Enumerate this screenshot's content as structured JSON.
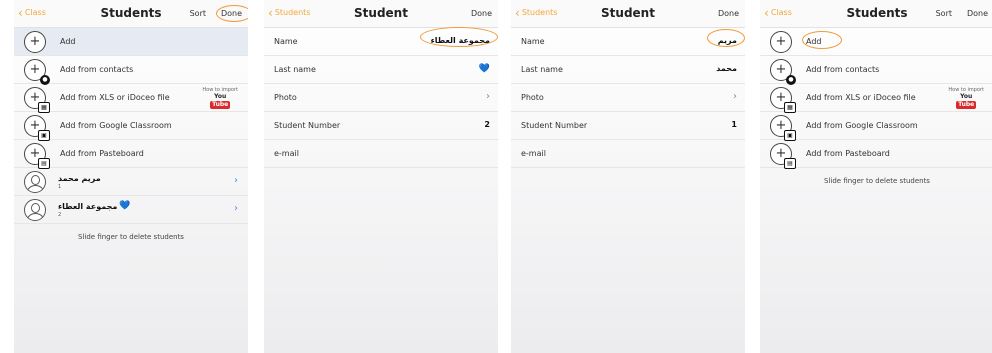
{
  "colors": {
    "accent": "#f2a63a",
    "annotation": "#f29a3a",
    "link_blue": "#4a90e2",
    "heart": "#2a7fe0"
  },
  "panel1": {
    "back_label": "Class",
    "title": "Students",
    "sort_label": "Sort",
    "done_label": "Done",
    "actions": [
      {
        "label": "Add",
        "icon": "add-icon"
      },
      {
        "label": "Add from contacts",
        "icon": "add-contact-icon"
      },
      {
        "label": "Add from XLS or iDoceo file",
        "icon": "add-file-icon"
      },
      {
        "label": "Add from Google Classroom",
        "icon": "add-classroom-icon"
      },
      {
        "label": "Add from Pasteboard",
        "icon": "add-pasteboard-icon"
      }
    ],
    "youtube": {
      "caption": "How to import",
      "logo_top": "You",
      "logo_bottom": "Tube"
    },
    "students": [
      {
        "name": "مريم محمد",
        "number": "1"
      },
      {
        "name": "مجموعة العطاء",
        "number": "2",
        "heart": "💙"
      }
    ],
    "footer": "Slide finger to delete students"
  },
  "panel2": {
    "back_label": "Students",
    "title": "Student",
    "done_label": "Done",
    "fields": {
      "name_label": "Name",
      "name_value": "مجموعة العطاء",
      "last_name_label": "Last name",
      "last_name_value": "💙",
      "photo_label": "Photo",
      "number_label": "Student Number",
      "number_value": "2",
      "email_label": "e-mail"
    }
  },
  "panel3": {
    "back_label": "Students",
    "title": "Student",
    "done_label": "Done",
    "fields": {
      "name_label": "Name",
      "name_value": "مريم",
      "last_name_label": "Last name",
      "last_name_value": "محمد",
      "photo_label": "Photo",
      "number_label": "Student Number",
      "number_value": "1",
      "email_label": "e-mail"
    }
  },
  "panel4": {
    "back_label": "Class",
    "title": "Students",
    "sort_label": "Sort",
    "done_label": "Done",
    "actions": [
      {
        "label": "Add"
      },
      {
        "label": "Add from contacts"
      },
      {
        "label": "Add from XLS or iDoceo file"
      },
      {
        "label": "Add from Google Classroom"
      },
      {
        "label": "Add from Pasteboard"
      }
    ],
    "youtube": {
      "caption": "How to import",
      "logo_top": "You",
      "logo_bottom": "Tube"
    },
    "footer": "Slide finger to delete students"
  }
}
